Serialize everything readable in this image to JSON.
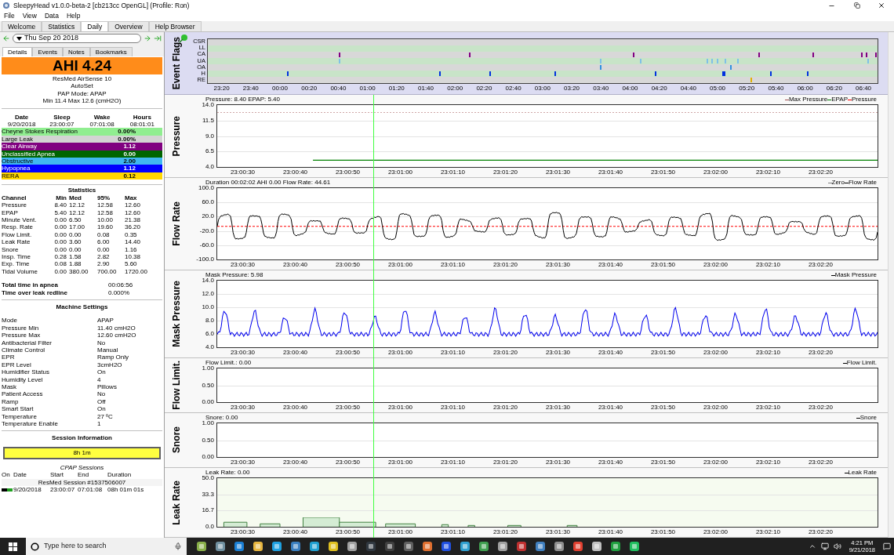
{
  "window": {
    "title": "SleepyHead v1.0.0-beta-2 [cb213cc OpenGL] (Profile: Ron)"
  },
  "menu": [
    "File",
    "View",
    "Data",
    "Help"
  ],
  "tabs": [
    {
      "label": "Welcome",
      "selected": false
    },
    {
      "label": "Statistics",
      "selected": false
    },
    {
      "label": "Daily",
      "selected": true
    },
    {
      "label": "Overview",
      "selected": false
    },
    {
      "label": "Help Browser",
      "selected": false
    }
  ],
  "date_nav": {
    "date": "Thu Sep 20 2018"
  },
  "detail_tabs": [
    {
      "label": "Details",
      "selected": true
    },
    {
      "label": "Events",
      "selected": false
    },
    {
      "label": "Notes",
      "selected": false
    },
    {
      "label": "Bookmarks",
      "selected": false
    }
  ],
  "summary": {
    "ahi": "AHI 4.24",
    "device_lines": [
      "ResMed AirSense 10",
      "AutoSet",
      "PAP Mode: APAP",
      "Min 11.4 Max 12.6 (cmH2O)"
    ]
  },
  "sleep_table": {
    "columns": [
      "Date",
      "Sleep",
      "Wake",
      "Hours"
    ],
    "values": [
      "9/20/2018",
      "23:00:07",
      "07:01:08",
      "08:01:01"
    ]
  },
  "events": [
    {
      "name": "Cheyne Stokes Respiration",
      "value": "0.00%",
      "color": "#90ee90"
    },
    {
      "name": "Large Leak",
      "value": "0.00%",
      "color": "#d3d3d3"
    },
    {
      "name": "Clear Airway",
      "value": "1.12",
      "color": "#800080"
    },
    {
      "name": "Unclassified Apnea",
      "value": "0.00",
      "color": "#006400"
    },
    {
      "name": "Obstructive",
      "value": "2.00",
      "color": "#40b8f0"
    },
    {
      "name": "Hypopnea",
      "value": "1.12",
      "color": "#0000ff"
    },
    {
      "name": "RERA",
      "value": "0.12",
      "color": "#ffd700"
    }
  ],
  "statistics": {
    "title": "Statistics",
    "columns": [
      "Channel",
      "Min",
      "Med",
      "95%",
      "Max"
    ],
    "rows": [
      [
        "Pressure",
        "8.40",
        "12.12",
        "12.58",
        "12.60"
      ],
      [
        "EPAP",
        "5.40",
        "12.12",
        "12.58",
        "12.60"
      ],
      [
        "Minute Vent.",
        "0.00",
        "6.50",
        "10.00",
        "21.38"
      ],
      [
        "Resp. Rate",
        "0.00",
        "17.00",
        "19.60",
        "36.20"
      ],
      [
        "Flow Limit.",
        "0.00",
        "0.00",
        "0.08",
        "0.35"
      ],
      [
        "Leak Rate",
        "0.00",
        "3.60",
        "6.00",
        "14.40"
      ],
      [
        "Snore",
        "0.00",
        "0.00",
        "0.00",
        "1.16"
      ],
      [
        "Insp. Time",
        "0.28",
        "1.58",
        "2.82",
        "10.38"
      ],
      [
        "Exp. Time",
        "0.08",
        "1.88",
        "2.90",
        "5.60"
      ],
      [
        "Tidal Volume",
        "0.00",
        "380.00",
        "700.00",
        "1720.00"
      ]
    ]
  },
  "totals": [
    {
      "label": "Total time in apnea",
      "value": "00:06:56"
    },
    {
      "label": "Time over leak redline",
      "value": "0.000%"
    }
  ],
  "machine_settings": {
    "title": "Machine Settings",
    "rows": [
      {
        "label": "Mode",
        "value": "APAP"
      },
      {
        "label": "Pressure Min",
        "value": "11.40 cmH2O"
      },
      {
        "label": "Pressure Max",
        "value": "12.60 cmH2O"
      },
      {
        "label": "Antibacterial Filter",
        "value": "No"
      },
      {
        "label": "Climate Control",
        "value": "Manual"
      },
      {
        "label": "EPR",
        "value": "Ramp Only"
      },
      {
        "label": "EPR Level",
        "value": "3cmH2O"
      },
      {
        "label": "Humidifier Status",
        "value": "On"
      },
      {
        "label": "Humidity Level",
        "value": "4"
      },
      {
        "label": "Mask",
        "value": "Pillows"
      },
      {
        "label": "Patient Access",
        "value": "No"
      },
      {
        "label": "Ramp",
        "value": "Off"
      },
      {
        "label": "Smart Start",
        "value": "On"
      },
      {
        "label": "Temperature",
        "value": "27 ºC"
      },
      {
        "label": "Temperature Enable",
        "value": "1"
      }
    ]
  },
  "session_info": {
    "title": "Session Information",
    "bar": "8h 1m",
    "cpap_title": "CPAP Sessions",
    "columns": [
      "On",
      "Date",
      "Start",
      "End",
      "Duration"
    ],
    "session_name": "ResMed Session #1537506007",
    "rows": [
      {
        "date": "9/20/2018",
        "start": "23:00:07",
        "end": "07:01:08",
        "duration": "08h 01m 01s"
      }
    ]
  },
  "event_flags": {
    "title": "Event Flags",
    "lanes": [
      {
        "label": "CSR"
      },
      {
        "label": "LL"
      },
      {
        "label": "CA",
        "color": "#800080"
      },
      {
        "label": "UA",
        "color": "#80c0e8"
      },
      {
        "label": "OA",
        "color": "#3090e0"
      },
      {
        "label": "H",
        "color": "#0030e0"
      },
      {
        "label": "RE",
        "color": "#e0b000"
      }
    ],
    "time_labels": [
      "23:20",
      "23:40",
      "00:00",
      "00:20",
      "00:40",
      "01:00",
      "01:20",
      "01:40",
      "02:00",
      "02:20",
      "02:40",
      "03:00",
      "03:20",
      "03:40",
      "04:00",
      "04:20",
      "04:40",
      "05:00",
      "05:20",
      "05:40",
      "06:00",
      "06:20",
      "06:40"
    ]
  },
  "graphs": [
    {
      "kind": "pressure",
      "title": "Pressure",
      "info": "Pressure: 8.40 EPAP: 5.40",
      "legend": [
        {
          "label": "Max Pressure",
          "color": "#a05050"
        },
        {
          "label": "EPAP",
          "color": "#008000"
        },
        {
          "label": "Pressure",
          "color": "#ff0000"
        }
      ],
      "yticks": [
        "14.0",
        "11.5",
        "9.0",
        "6.5",
        "4.0"
      ],
      "xticks": [
        "23:00:30",
        "23:00:40",
        "23:00:50",
        "23:01:00",
        "23:01:10",
        "23:01:20",
        "23:01:30",
        "23:01:40",
        "23:01:50",
        "23:02:00",
        "23:02:10",
        "23:02:20"
      ]
    },
    {
      "kind": "flow",
      "title": "Flow Rate",
      "info": "Duration 00:02:02 AHI 0.00 Flow Rate: 44.61",
      "legend": [
        {
          "label": "Zero",
          "color": "#808080"
        },
        {
          "label": "Flow Rate",
          "color": "#000000"
        }
      ],
      "yticks": [
        "100.0",
        "60.0",
        "20.0",
        "-20.0",
        "-60.0",
        "-100.0"
      ],
      "xticks": [
        "23:00:30",
        "23:00:40",
        "23:00:50",
        "23:01:00",
        "23:01:10",
        "23:01:20",
        "23:01:30",
        "23:01:40",
        "23:01:50",
        "23:02:00",
        "23:02:10",
        "23:02:20"
      ]
    },
    {
      "kind": "mask",
      "title": "Mask Pressure",
      "info": "Mask Pressure: 5.98",
      "legend": [
        {
          "label": "Mask Pressure",
          "color": "#000000"
        }
      ],
      "yticks": [
        "14.0",
        "12.0",
        "10.0",
        "8.0",
        "6.0",
        "4.0"
      ],
      "xticks": [
        "23:00:30",
        "23:00:40",
        "23:00:50",
        "23:01:00",
        "23:01:10",
        "23:01:20",
        "23:01:30",
        "23:01:40",
        "23:01:50",
        "23:02:00",
        "23:02:10",
        "23:02:20"
      ]
    },
    {
      "kind": "flat",
      "title": "Flow Limit.",
      "info": "Flow Limit.: 0.00",
      "legend": [
        {
          "label": "Flow Limit.",
          "color": "#000000"
        }
      ],
      "yticks": [
        "1.00",
        "0.50",
        "0.00"
      ],
      "xticks": [
        "23:00:30",
        "23:00:40",
        "23:00:50",
        "23:01:00",
        "23:01:10",
        "23:01:20",
        "23:01:30",
        "23:01:40",
        "23:01:50",
        "23:02:00",
        "23:02:10",
        "23:02:20"
      ]
    },
    {
      "kind": "flat",
      "title": "Snore",
      "info": "Snore: 0.00",
      "legend": [
        {
          "label": "Snore",
          "color": "#000000"
        }
      ],
      "yticks": [
        "1.00",
        "0.50",
        "0.00"
      ],
      "xticks": [
        "23:00:30",
        "23:00:40",
        "23:00:50",
        "23:01:00",
        "23:01:10",
        "23:01:20",
        "23:01:30",
        "23:01:40",
        "23:01:50",
        "23:02:00",
        "23:02:10",
        "23:02:20"
      ]
    },
    {
      "kind": "leak",
      "title": "Leak Rate",
      "info": "Leak Rate: 0.00",
      "legend": [
        {
          "label": "Leak Rate",
          "color": "#000000"
        }
      ],
      "yticks": [
        "50.0",
        "33.3",
        "16.7",
        "0.0"
      ],
      "xticks": [
        "23:00:30",
        "23:00:40",
        "23:00:50",
        "23:01:00",
        "23:01:10",
        "23:01:20",
        "23:01:30",
        "23:01:40",
        "23:01:50",
        "23:02:00",
        "23:02:10",
        "23:02:20"
      ]
    }
  ],
  "taskbar": {
    "search_placeholder": "Type here to search",
    "time": "4:21 PM",
    "date": "9/21/2018"
  }
}
